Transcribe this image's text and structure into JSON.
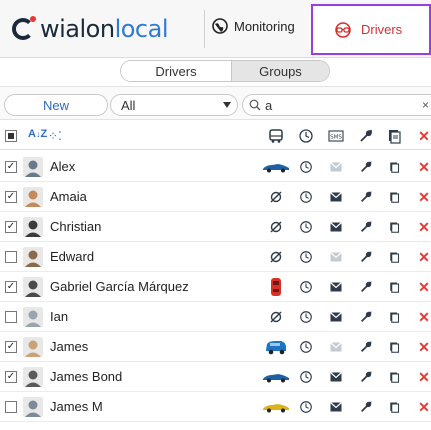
{
  "header": {
    "logo_main": "wialon",
    "logo_light": "local",
    "monitoring_label": "Monitoring",
    "drivers_label": "Drivers",
    "brand_red": "#d32f2f",
    "highlight_color": "#9c3de0"
  },
  "toggle": {
    "drivers": "Drivers",
    "groups": "Groups"
  },
  "filters": {
    "new_label": "New",
    "select_value": "All",
    "search_value": "a",
    "clear": "×"
  },
  "column_header": {
    "sort_icon": "sort-az-icon",
    "group_icon": "group-icon",
    "columns": [
      "unit-icon",
      "clock-icon",
      "sms-icon",
      "wrench-icon",
      "copy-icon",
      "delete-icon"
    ]
  },
  "rows": [
    {
      "name": "Alex",
      "checked": true,
      "car": "blue-sports-car",
      "sms_active": false
    },
    {
      "name": "Amaia",
      "checked": true,
      "car": "none",
      "sms_active": true
    },
    {
      "name": "Christian",
      "checked": true,
      "car": "none",
      "sms_active": true
    },
    {
      "name": "Edward",
      "checked": false,
      "car": "none",
      "sms_active": false
    },
    {
      "name": "Gabriel García Márquez",
      "checked": true,
      "car": "red-car-top-view",
      "sms_active": true
    },
    {
      "name": "Ian",
      "checked": false,
      "car": "none",
      "sms_active": true
    },
    {
      "name": "James",
      "checked": true,
      "car": "blue-suv",
      "sms_active": false
    },
    {
      "name": "James Bond",
      "checked": true,
      "car": "blue-sports-car",
      "sms_active": true
    },
    {
      "name": "James M",
      "checked": false,
      "car": "yellow-sports-car",
      "sms_active": true
    }
  ]
}
